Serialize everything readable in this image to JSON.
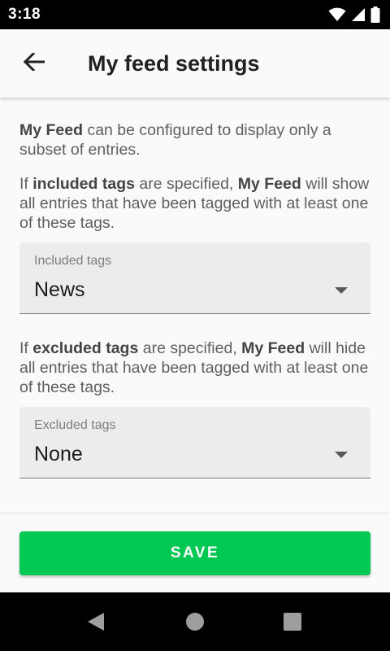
{
  "status_bar": {
    "time": "3:18",
    "icons": [
      "wifi-icon",
      "cell-signal-icon",
      "battery-icon"
    ]
  },
  "app_bar": {
    "back_icon": "arrow-back-icon",
    "title": "My feed settings"
  },
  "intro": {
    "p1_bold": "My Feed",
    "p1_rest": " can be configured to display only a subset of entries.",
    "p2_pre": "If ",
    "p2_bold1": "included tags",
    "p2_mid": " are specified, ",
    "p2_bold2": "My Feed",
    "p2_rest": " will show all entries that have been tagged with at least one of these tags."
  },
  "included_tags": {
    "label": "Included tags",
    "value": "News"
  },
  "excluded_info": {
    "pre": "If ",
    "bold1": "excluded tags",
    "mid": " are specified, ",
    "bold2": "My Feed",
    "rest": " will hide all entries that have been tagged with at least one of these tags."
  },
  "excluded_tags": {
    "label": "Excluded tags",
    "value": "None"
  },
  "save_button": {
    "label": "SAVE"
  },
  "colors": {
    "accent": "#00c853",
    "background": "#fafafa",
    "field_background": "#ececec"
  },
  "nav_bar": {
    "icons": [
      "nav-back-icon",
      "nav-home-icon",
      "nav-recents-icon"
    ]
  }
}
